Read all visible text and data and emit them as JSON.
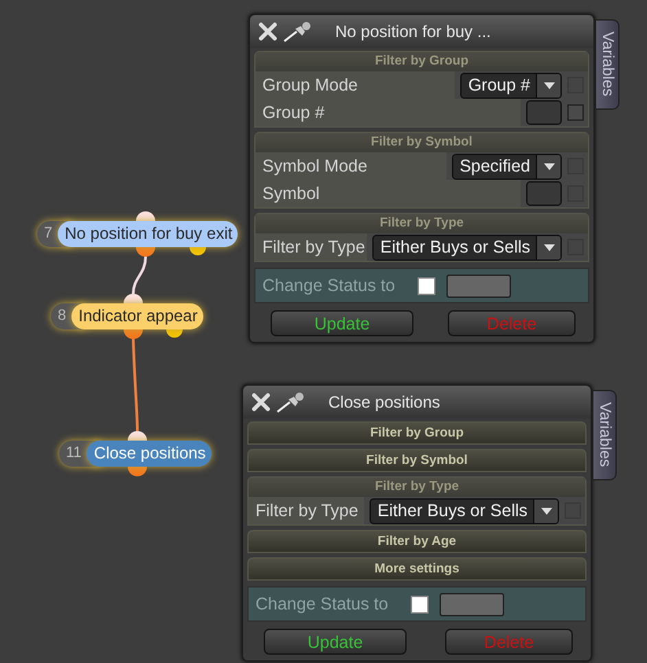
{
  "nodes": [
    {
      "number": "7",
      "label": "No position for buy exit",
      "color": "#a9c9f7"
    },
    {
      "number": "8",
      "label": "Indicator appear",
      "color": "#fbd06a"
    },
    {
      "number": "11",
      "label": "Close positions",
      "color": "#4a84bd"
    }
  ],
  "panels": [
    {
      "title": "No position for buy ...",
      "tab": "Variables",
      "sections": [
        {
          "kind": "open",
          "heading": "Filter by Group",
          "rows": [
            {
              "label": "Group Mode",
              "kind": "select",
              "value": "Group #",
              "checked": false
            },
            {
              "label": "Group #",
              "kind": "input",
              "checked": false
            }
          ]
        },
        {
          "kind": "open",
          "heading": "Filter by Symbol",
          "rows": [
            {
              "label": "Symbol Mode",
              "kind": "select",
              "value": "Specified",
              "checked": false
            },
            {
              "label": "Symbol",
              "kind": "input",
              "checked": false
            }
          ]
        },
        {
          "kind": "open",
          "heading": "Filter by Type",
          "rows": [
            {
              "label": "Filter by Type",
              "kind": "select",
              "value": "Either Buys or Sells",
              "checked": false
            }
          ]
        }
      ],
      "status": {
        "label": "Change Status to",
        "checked": false
      },
      "buttons": [
        {
          "label": "Update",
          "kind": "confirm"
        },
        {
          "label": "Delete",
          "kind": "danger"
        }
      ]
    },
    {
      "title": "Close positions",
      "tab": "Variables",
      "sections": [
        {
          "kind": "collapsed",
          "heading": "Filter by Group"
        },
        {
          "kind": "collapsed",
          "heading": "Filter by Symbol"
        },
        {
          "kind": "open",
          "heading": "Filter by Type",
          "rows": [
            {
              "label": "Filter by Type",
              "kind": "select",
              "value": "Either Buys or Sells",
              "checked": false
            }
          ]
        },
        {
          "kind": "collapsed",
          "heading": "Filter by Age"
        },
        {
          "kind": "collapsed",
          "heading": "More settings"
        }
      ],
      "status": {
        "label": "Change Status to",
        "checked": false
      },
      "buttons": [
        {
          "label": "Update",
          "kind": "confirm"
        },
        {
          "label": "Delete",
          "kind": "danger"
        }
      ]
    }
  ]
}
